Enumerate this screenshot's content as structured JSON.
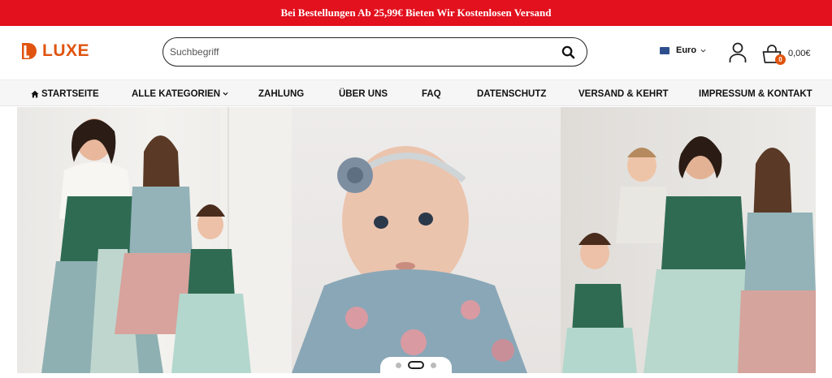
{
  "promo": {
    "text": "Bei Bestellungen Ab 25,99€ Bieten Wir Kostenlosen Versand"
  },
  "brand": {
    "logo_text": "LUXE",
    "accent": "#e05410",
    "promo_color": "#e3101d"
  },
  "search": {
    "placeholder": "Suchbegriff",
    "icon": "search-icon"
  },
  "currency": {
    "label": "Euro",
    "icon": "flag-icon"
  },
  "cart": {
    "count": "0",
    "total": "0,00€"
  },
  "nav": {
    "items": [
      {
        "label": "STARTSEITE",
        "icon": "home-icon"
      },
      {
        "label": "ALLE KATEGORIEN",
        "icon": "chevron-down-icon"
      },
      {
        "label": "ZAHLUNG"
      },
      {
        "label": "ÜBER UNS"
      },
      {
        "label": "FAQ"
      },
      {
        "label": "DATENSCHUTZ"
      },
      {
        "label": "VERSAND & KEHRT"
      },
      {
        "label": "IMPRESSUM & KONTAKT"
      }
    ]
  },
  "slider": {
    "dot_count": 3,
    "active_index": 1
  }
}
